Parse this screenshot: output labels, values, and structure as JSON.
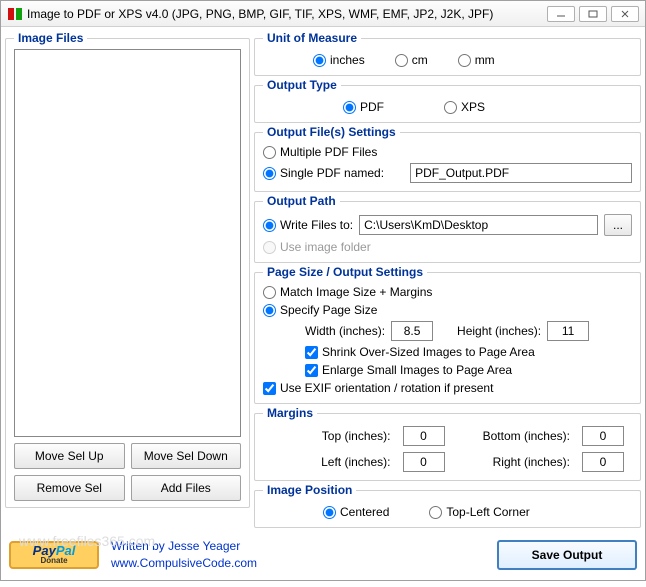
{
  "window": {
    "title": "Image to PDF or XPS  v4.0   (JPG, PNG, BMP, GIF, TIF, XPS, WMF, EMF, JP2, J2K, JPF)"
  },
  "left": {
    "legend": "Image Files",
    "moveUp": "Move Sel Up",
    "moveDown": "Move Sel Down",
    "removeSel": "Remove Sel",
    "addFiles": "Add Files"
  },
  "unit": {
    "legend": "Unit of Measure",
    "inches": "inches",
    "cm": "cm",
    "mm": "mm"
  },
  "outputType": {
    "legend": "Output Type",
    "pdf": "PDF",
    "xps": "XPS"
  },
  "outputFiles": {
    "legend": "Output File(s) Settings",
    "multiple": "Multiple PDF Files",
    "singleNamed": "Single PDF named:",
    "filename": "PDF_Output.PDF"
  },
  "outputPath": {
    "legend": "Output Path",
    "writeTo": "Write Files to:",
    "path": "C:\\Users\\KmD\\Desktop",
    "browse": "...",
    "useImageFolder": "Use image folder"
  },
  "pageSize": {
    "legend": "Page Size / Output Settings",
    "matchImage": "Match Image Size + Margins",
    "specify": "Specify Page Size",
    "widthLabel": "Width (inches):",
    "width": "8.5",
    "heightLabel": "Height (inches):",
    "height": "11",
    "shrink": "Shrink Over-Sized Images to Page Area",
    "enlarge": "Enlarge Small Images to Page Area",
    "useExif": "Use EXIF orientation / rotation if present"
  },
  "margins": {
    "legend": "Margins",
    "topLabel": "Top (inches):",
    "top": "0",
    "bottomLabel": "Bottom (inches):",
    "bottom": "0",
    "leftLabel": "Left (inches):",
    "left": "0",
    "rightLabel": "Right (inches):",
    "right": "0"
  },
  "imagePos": {
    "legend": "Image Position",
    "centered": "Centered",
    "topLeft": "Top-Left Corner"
  },
  "footer": {
    "written": "Written by Jesse Yeager",
    "url": "www.CompulsiveCode.com",
    "save": "Save Output",
    "watermark": "www.freefiles365.com"
  }
}
